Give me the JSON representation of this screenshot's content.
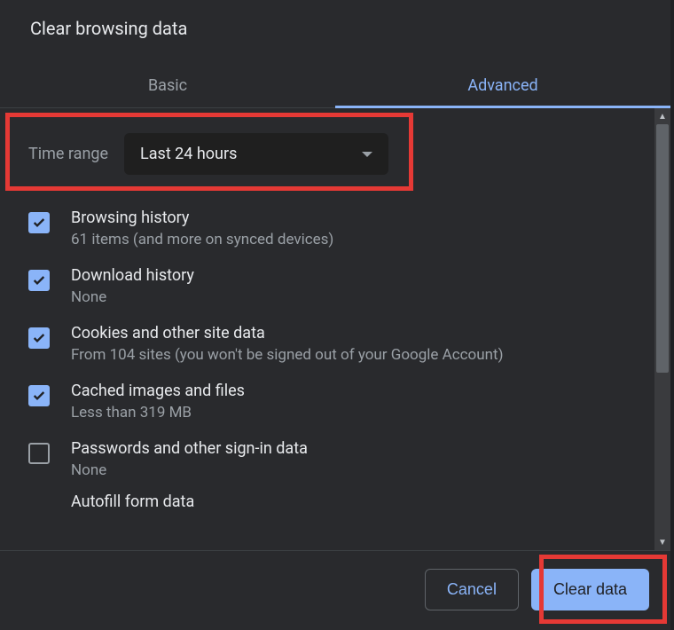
{
  "title": "Clear browsing data",
  "tabs": {
    "basic": "Basic",
    "advanced": "Advanced"
  },
  "timeRange": {
    "label": "Time range",
    "value": "Last 24 hours"
  },
  "items": [
    {
      "title": "Browsing history",
      "sub": "61 items (and more on synced devices)",
      "checked": true
    },
    {
      "title": "Download history",
      "sub": "None",
      "checked": true
    },
    {
      "title": "Cookies and other site data",
      "sub": "From 104 sites (you won't be signed out of your Google Account)",
      "checked": true
    },
    {
      "title": "Cached images and files",
      "sub": "Less than 319 MB",
      "checked": true
    },
    {
      "title": "Passwords and other sign-in data",
      "sub": "None",
      "checked": false
    },
    {
      "title": "Autofill form data",
      "sub": "",
      "checked": false
    }
  ],
  "buttons": {
    "cancel": "Cancel",
    "clear": "Clear data"
  }
}
